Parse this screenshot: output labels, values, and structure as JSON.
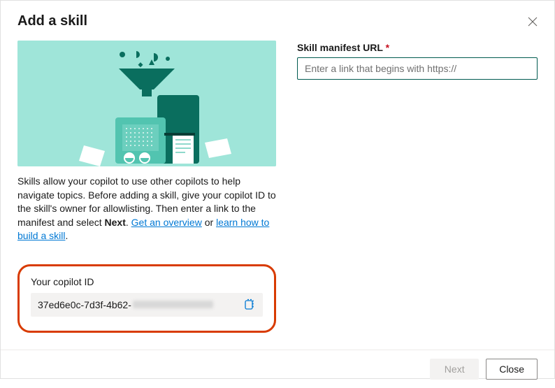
{
  "dialog": {
    "title": "Add a skill",
    "description_1": "Skills allow your copilot to use other copilots to help navigate topics. Before adding a skill, give your copilot ID to the skill's owner for allowlisting. Then enter a link to the manifest and select ",
    "description_bold": "Next",
    "description_2": ". ",
    "overview_link": "Get an overview",
    "description_or": " or ",
    "learnhow_link": "learn how to build a skill",
    "description_end": "."
  },
  "copilot": {
    "label": "Your copilot ID",
    "id_visible": "37ed6e0c-7d3f-4b62-"
  },
  "form": {
    "label": "Skill manifest URL",
    "required": "*",
    "placeholder": "Enter a link that begins with https://",
    "value": ""
  },
  "footer": {
    "next": "Next",
    "close": "Close"
  }
}
